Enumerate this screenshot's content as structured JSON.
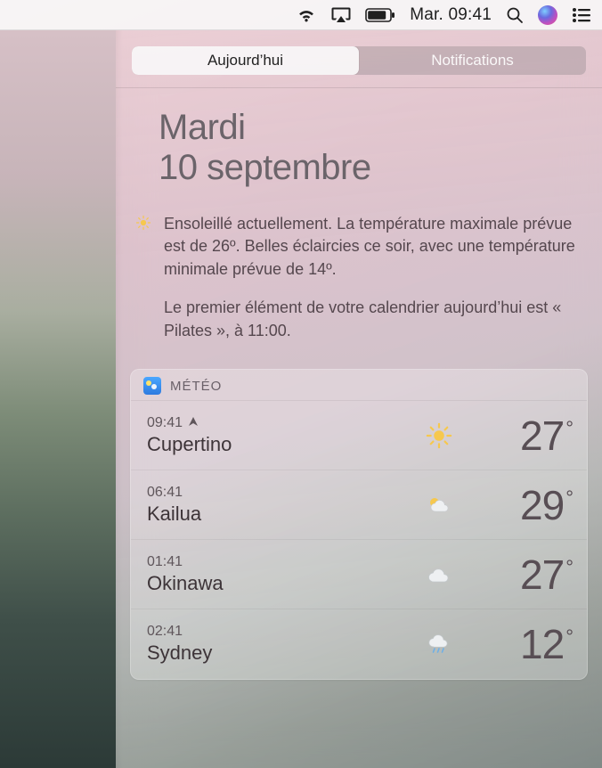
{
  "menubar": {
    "clock": "Mar. 09:41"
  },
  "nc": {
    "tabs": {
      "today": "Aujourd’hui",
      "notifications": "Notifications"
    },
    "date": {
      "day": "Mardi",
      "full": "10 septembre"
    },
    "summary": {
      "weather": "Ensoleillé actuellement. La température maximale prévue est de 26º. Belles éclaircies ce soir, avec une température minimale prévue de 14º.",
      "calendar": "Le premier élément de votre calendrier aujourd’hui est « Pilates »,  à 11:00."
    }
  },
  "weather": {
    "title": "MÉTÉO",
    "rows": [
      {
        "time": "09:41",
        "city": "Cupertino",
        "temp": "27",
        "icon": "sun",
        "current": true
      },
      {
        "time": "06:41",
        "city": "Kailua",
        "temp": "29",
        "icon": "partial",
        "current": false
      },
      {
        "time": "01:41",
        "city": "Okinawa",
        "temp": "27",
        "icon": "cloud",
        "current": false
      },
      {
        "time": "02:41",
        "city": "Sydney",
        "temp": "12",
        "icon": "rain",
        "current": false
      }
    ]
  }
}
